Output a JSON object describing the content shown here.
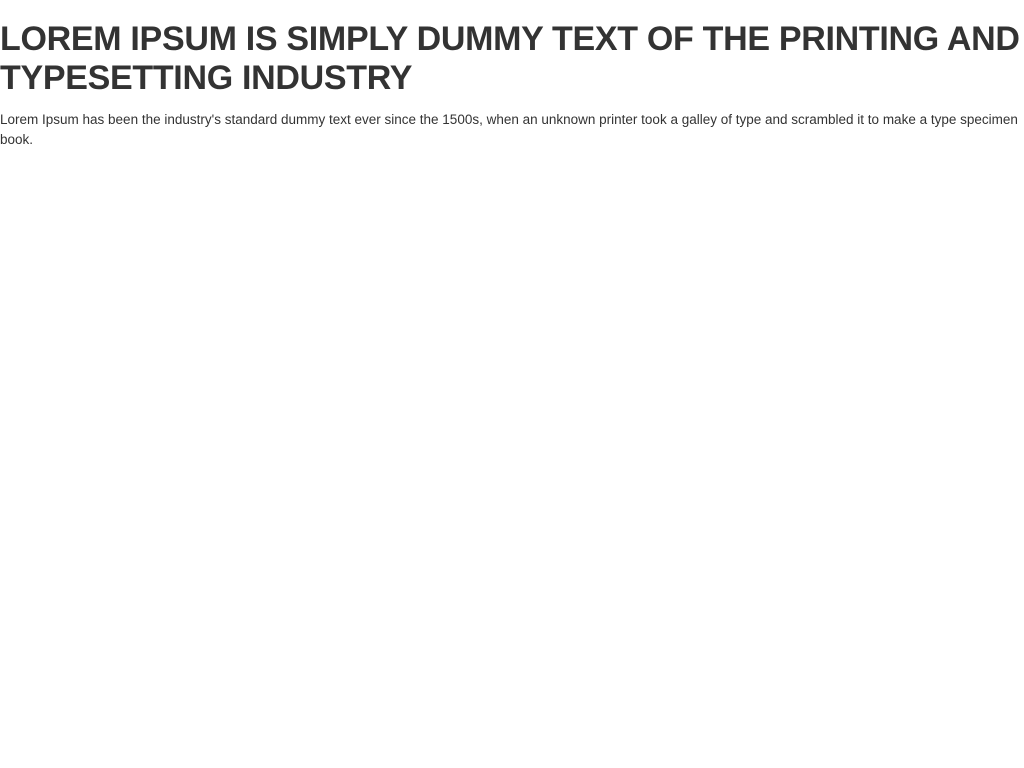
{
  "heading": {
    "text": "LOREM IPSUM IS SIMPLY DUMMY TEXT OF THE PRINTING AND TYPESETTING INDUSTRY"
  },
  "body": {
    "text": "Lorem Ipsum has been the industry's standard dummy text ever since the 1500s, when an unknown printer took a galley of type and scrambled it to make a type specimen book."
  },
  "colors": {
    "text": "#333333",
    "background": "#ffffff"
  }
}
